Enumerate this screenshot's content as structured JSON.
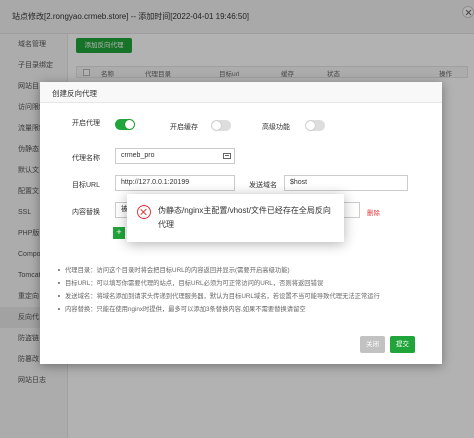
{
  "window": {
    "title": "站点修改[2.rongyao.crmeb.store] -- 添加时间[2022-04-01 19:46:50]"
  },
  "sidebar": {
    "items": [
      {
        "label": "域名管理"
      },
      {
        "label": "子目录绑定"
      },
      {
        "label": "网站目"
      },
      {
        "label": "访问限制"
      },
      {
        "label": "流量限制"
      },
      {
        "label": "伪静态"
      },
      {
        "label": "默认文"
      },
      {
        "label": "配置文"
      },
      {
        "label": "SSL"
      },
      {
        "label": "PHP版"
      },
      {
        "label": "Compo"
      },
      {
        "label": "Tomcat"
      },
      {
        "label": "重定向"
      },
      {
        "label": "反向代"
      },
      {
        "label": "防盗链"
      },
      {
        "label": "防篡改"
      },
      {
        "label": "网站日志"
      }
    ]
  },
  "background_panel": {
    "add_button": "添加反向代理",
    "columns": [
      "名称",
      "代理目录",
      "目标url",
      "缓存",
      "状态",
      "操作"
    ]
  },
  "modal": {
    "title": "创建反向代理",
    "enable_proxy_label": "开启代理",
    "enable_cache_label": "开启缓存",
    "advanced_label": "高级功能",
    "name_label": "代理名称",
    "name_value": "crmeb_pro",
    "target_url_label": "目标URL",
    "target_url_value": "http://127.0.0.1:20199",
    "send_domain_label": "发送域名",
    "send_domain_value": "$host",
    "content_replace_label": "内容替换",
    "content_replace_placeholder": "被",
    "delete_link": "删除",
    "add_icon": "+",
    "tips": [
      "代理目录：访问这个目录时将会把目标URL的内容返回并显示(需要开启高级功能)",
      "目标URL：可以填写你需要代理的站点，目标URL必须为可正常访问的URL，否则将返回错误",
      "发送域名：将域名添加到请求头传递到代理服务器，默认为目标URL域名，若设置不当可能导致代理无法正常运行",
      "内容替换：只能在使用nginx时提供，最多可以添加3条替换内容,如果不需要替换请留空"
    ],
    "close_button": "关闭",
    "submit_button": "提交"
  },
  "toast": {
    "message": "伪静态/nginx主配置/vhost/文件已经存在全局反向代理"
  },
  "colors": {
    "accent": "#20a53a",
    "error": "#e4393c"
  }
}
